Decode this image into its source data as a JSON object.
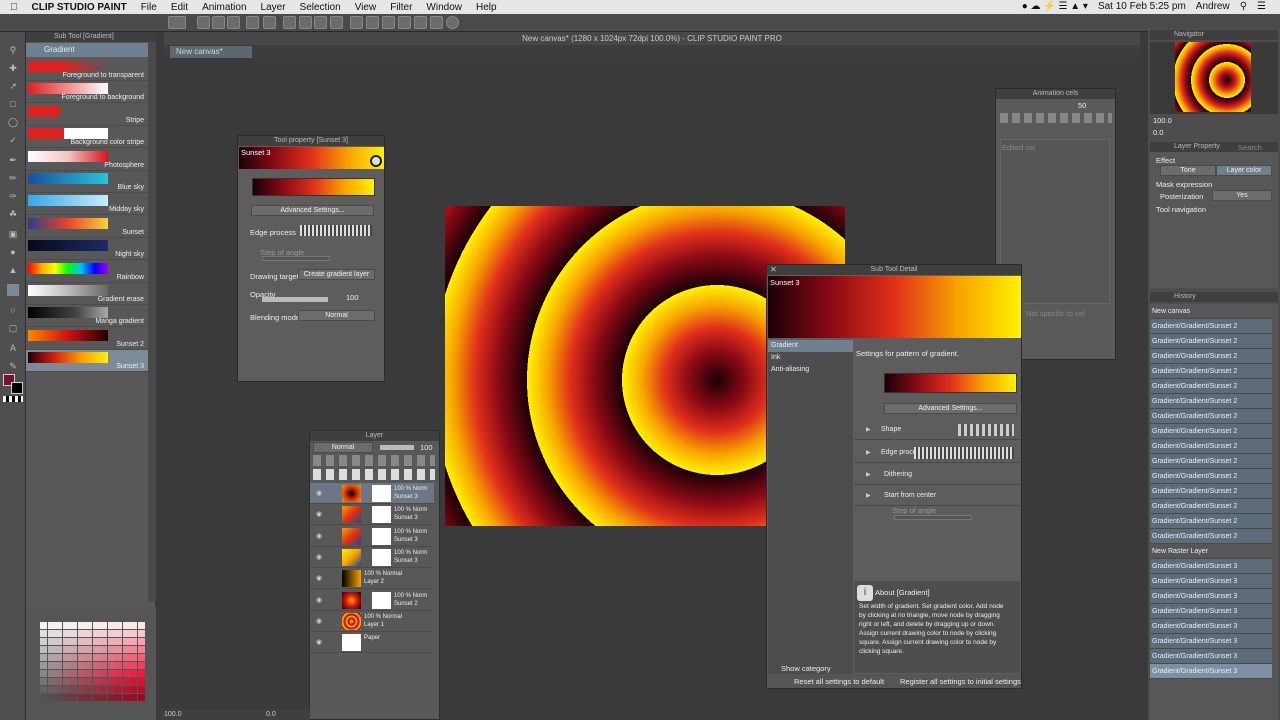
{
  "menubar": {
    "app": "CLIP STUDIO PAINT",
    "items": [
      "File",
      "Edit",
      "Animation",
      "Layer",
      "Selection",
      "View",
      "Filter",
      "Window",
      "Help"
    ],
    "datetime": "Sat 10 Feb  5:25 pm",
    "user": "Andrew"
  },
  "window_title": "New canvas* (1280 x 1024px 72dpi 100.0%)  - CLIP STUDIO PAINT PRO",
  "canvas_tab": "New canvas*",
  "subtool": {
    "header": "Sub Tool [Gradient]",
    "group": "Gradient",
    "items": [
      {
        "label": "Foreground to transparent",
        "gradient": "linear-gradient(90deg,#e0201e,#e0201e 40%,rgba(224,32,30,0))"
      },
      {
        "label": "Foreground to background",
        "gradient": "linear-gradient(90deg,#e0201e,#fff)"
      },
      {
        "label": "Stripe",
        "gradient": "linear-gradient(90deg,#e0201e 0,#e0201e 40%,transparent 40%)"
      },
      {
        "label": "Background color stripe",
        "gradient": "linear-gradient(90deg,#e0201e 0,#e0201e 45%,#fff 45%)"
      },
      {
        "label": "Photosphere",
        "gradient": "linear-gradient(90deg,#fff,#f3c5c5,#d8141b)"
      },
      {
        "label": "Blue sky",
        "gradient": "linear-gradient(90deg,#1b4f9c,#29c4d8)"
      },
      {
        "label": "Midday sky",
        "gradient": "linear-gradient(90deg,#36a7e6,#c8ecfb)"
      },
      {
        "label": "Sunset",
        "gradient": "linear-gradient(90deg,#2a3d8f,#e8452a,#f7d23b)"
      },
      {
        "label": "Night sky",
        "gradient": "linear-gradient(90deg,#080818,#1d2a6a)"
      },
      {
        "label": "Rainbow",
        "gradient": "linear-gradient(90deg,#ff0000,#ffa500,#ffff00,#00ff00,#00c0ff,#0000ff,#a000ff)"
      },
      {
        "label": "Gradient erase",
        "gradient": "linear-gradient(90deg,#fff,#bcbcbc,#666)"
      },
      {
        "label": "Manga gradient",
        "gradient": "linear-gradient(90deg,#000,#444 60%,#aaa)"
      },
      {
        "label": "Sunset 2",
        "gradient": "linear-gradient(90deg,#ff8800,#d01010,#200000)"
      },
      {
        "label": "Sunset 3",
        "gradient": "linear-gradient(90deg,#200008,#d82010,#f8a000,#fff200)"
      }
    ]
  },
  "toolprop": {
    "title": "Tool property [Sunset 3]",
    "name": "Sunset 3",
    "advanced": "Advanced Settings...",
    "edge_process": "Edge process",
    "step_of_angle": "Step of angle",
    "drawing_target_label": "Drawing target",
    "drawing_target_value": "Create gradient layer",
    "opacity_label": "Opacity",
    "opacity_value": "100",
    "blending_label": "Blending mode",
    "blending_value": "Normal"
  },
  "layers": {
    "title": "Layer",
    "mode": "Normal",
    "opacity": "100",
    "rows": [
      {
        "line1": "100 % Norm",
        "line2": "Sunset 3"
      },
      {
        "line1": "100 % Norm",
        "line2": "Sunset 3"
      },
      {
        "line1": "100 % Norm",
        "line2": "Sunset 3"
      },
      {
        "line1": "100 % Norm",
        "line2": "Sunset 3"
      },
      {
        "line1": "100 % Normal",
        "line2": "Layer 2"
      },
      {
        "line1": "100 % Norm",
        "line2": "Sunset 2"
      },
      {
        "line1": "100 % Normal",
        "line2": "Layer 1"
      },
      {
        "line1": "",
        "line2": "Paper"
      }
    ]
  },
  "animcels": {
    "title": "Animation cels",
    "value": "50",
    "edited": "Edited cel",
    "not_specific": "Not specific to cel"
  },
  "subdetail": {
    "title": "Sub Tool Detail",
    "name": "Sunset 3",
    "categories": [
      "Gradient",
      "Ink",
      "Anti-aliasing"
    ],
    "description": "Settings for pattern of gradient.",
    "advanced": "Advanced Settings...",
    "shape": "Shape",
    "edge_process": "Edge process",
    "dithering": "Dithering",
    "start_from_center": "Start from center",
    "step_of_angle": "Step of angle",
    "about_title": "About [Gradient]",
    "about_text": "Set width of gradient. Set gradient color. Add node by clicking at no triangle, move node by dragging right or left, and delete by dragging up or down. Assign current drawing color to node by clicking square. Assign current drawing color to node by clicking square.",
    "show_category": "Show category",
    "reset": "Reset all settings to default",
    "register": "Register all settings to initial settings"
  },
  "navigator": {
    "title": "Navigator",
    "zoom": "100.0",
    "angle": "0.0"
  },
  "layerprop": {
    "title": "Layer Property",
    "search_tab": "Search Layer",
    "effect": "Effect",
    "tone": "Tone",
    "layer_color": "Layer color",
    "mask_expression": "Mask expression",
    "posterization": "Posterization",
    "posterization_value": "Yes",
    "tool_navigation": "Tool navigation"
  },
  "history": {
    "title": "History",
    "items": [
      "New canvas",
      "Gradient/Gradient/Sunset 2",
      "Gradient/Gradient/Sunset 2",
      "Gradient/Gradient/Sunset 2",
      "Gradient/Gradient/Sunset 2",
      "Gradient/Gradient/Sunset 2",
      "Gradient/Gradient/Sunset 2",
      "Gradient/Gradient/Sunset 2",
      "Gradient/Gradient/Sunset 2",
      "Gradient/Gradient/Sunset 2",
      "Gradient/Gradient/Sunset 2",
      "Gradient/Gradient/Sunset 2",
      "Gradient/Gradient/Sunset 2",
      "Gradient/Gradient/Sunset 2",
      "Gradient/Gradient/Sunset 2",
      "Gradient/Gradient/Sunset 2",
      "New Raster Layer",
      "Gradient/Gradient/Sunset 3",
      "Gradient/Gradient/Sunset 3",
      "Gradient/Gradient/Sunset 3",
      "Gradient/Gradient/Sunset 3",
      "Gradient/Gradient/Sunset 3",
      "Gradient/Gradient/Sunset 3",
      "Gradient/Gradient/Sunset 3",
      "Gradient/Gradient/Sunset 3"
    ]
  },
  "status": {
    "zoom": "100.0",
    "angle": "0.0"
  },
  "colors": {
    "accent": "#6e7f90",
    "gradient_main": "linear-gradient(90deg,#1a0008,#8a0a14,#e0301a,#f8a200,#fff200)"
  }
}
